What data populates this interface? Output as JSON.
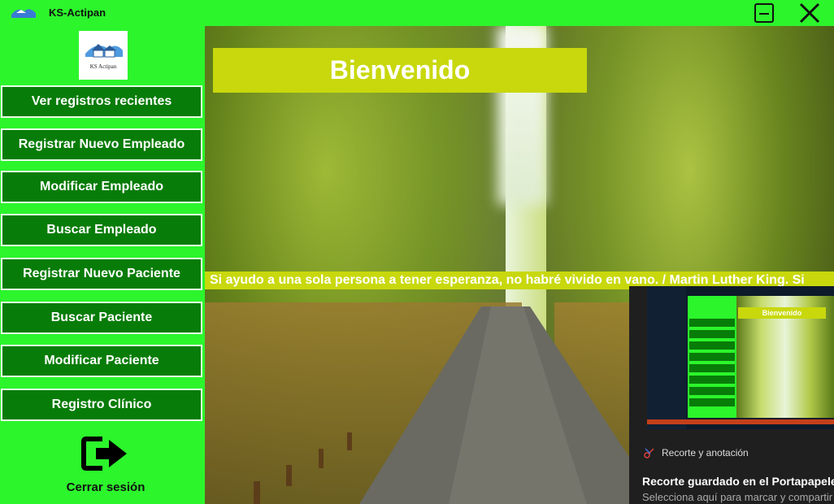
{
  "window": {
    "title": "KS-Actipan",
    "logo_text": "KS Actipan"
  },
  "sidebar": {
    "items": [
      {
        "label": "Ver registros recientes"
      },
      {
        "label": "Registrar Nuevo Empleado"
      },
      {
        "label": "Modificar Empleado"
      },
      {
        "label": "Buscar Empleado"
      },
      {
        "label": "Registrar Nuevo Paciente"
      },
      {
        "label": "Buscar Paciente"
      },
      {
        "label": "Modificar Paciente"
      },
      {
        "label": "Registro Clínico"
      }
    ],
    "logout_label": "Cerrar sesión"
  },
  "main": {
    "welcome": "Bienvenido",
    "quote": "Si ayudo a una sola persona a tener esperanza, no habré vivido en vano. / Martin Luther King. Si"
  },
  "notification": {
    "app": "Recorte y anotación",
    "title": "Recorte guardado en el Portapapeles",
    "subtitle": "Selecciona aquí para marcar y compartir",
    "thumb_welcome": "Bienvenido"
  },
  "colors": {
    "app_green": "#2cf52c",
    "button_green": "#087c08",
    "banner_yellow": "#c8d80c"
  }
}
